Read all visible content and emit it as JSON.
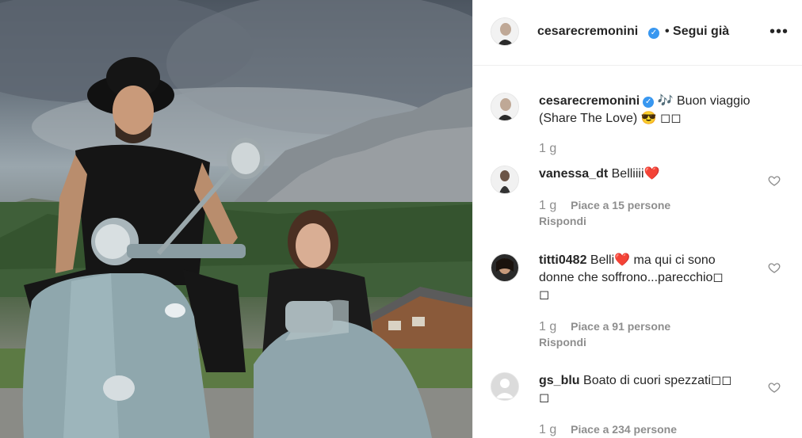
{
  "post": {
    "photo_alt": "Foto del post",
    "author": "cesarecremonini",
    "follow_status": "• Segui già",
    "more_label": "•••"
  },
  "caption": {
    "author": "cesarecremonini",
    "text_line1": "🎶 Buon viaggio",
    "text_line2": "(Share The Love) 😎 ◻◻",
    "time": "1 g"
  },
  "comments": [
    {
      "user": "vanessa_dt",
      "text": "Belliiii❤️",
      "time": "1 g",
      "likes": "Piace a 15 persone",
      "reply": "Rispondi"
    },
    {
      "user": "titti0482",
      "text_line1_a": "Belli",
      "text_line1_heart": "❤️",
      "text_line1_b": " ma qui ci sono",
      "text_line2": "donne che soffrono...parecchio◻",
      "text_line3": "◻",
      "time": "1 g",
      "likes": "Piace a 91 persone",
      "reply": "Rispondi"
    },
    {
      "user": "gs_blu",
      "text_line1": "Boato di cuori spezzati◻◻",
      "text_line2": "◻",
      "time": "1 g",
      "likes": "Piace a 234 persone"
    }
  ],
  "icons": {
    "verified": "verified-badge-icon",
    "heart": "heart-outline-icon",
    "more": "more-options-icon"
  },
  "colors": {
    "verified": "#3897f0",
    "meta_text": "#8e8e8e",
    "text": "#262626"
  }
}
